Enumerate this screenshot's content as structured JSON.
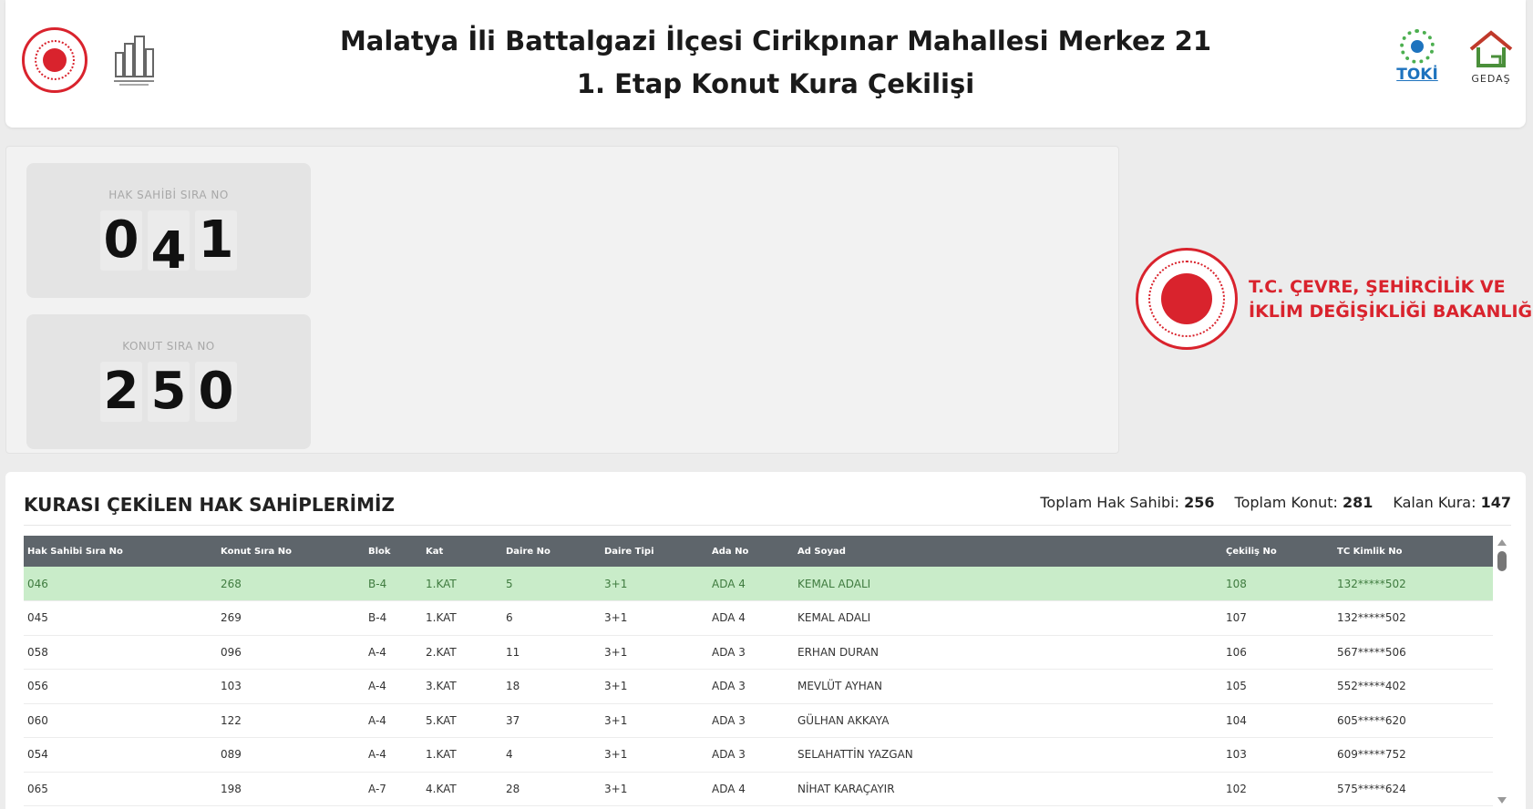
{
  "header": {
    "title_line1": "Malatya İli Battalgazi İlçesi Cirikpınar Mahallesi Merkez 21",
    "title_line2": "1. Etap Konut Kura Çekilişi",
    "toki_label": "TOKİ",
    "gedas_label": "GEDAŞ"
  },
  "counters": {
    "hak_sahibi": {
      "label": "HAK SAHİBİ SIRA NO",
      "digits": [
        "0",
        "4",
        "1"
      ]
    },
    "konut": {
      "label": "KONUT SIRA NO",
      "digits": [
        "2",
        "5",
        "0"
      ]
    }
  },
  "ministry": {
    "line1": "T.C. ÇEVRE, ŞEHİRCİLİK VE",
    "line2": "İKLİM DEĞİŞİKLİĞİ BAKANLIĞI"
  },
  "list": {
    "title": "KURASI ÇEKİLEN HAK SAHİPLERİMİZ",
    "stats": {
      "hak_sahibi_label": "Toplam Hak Sahibi:",
      "hak_sahibi_value": "256",
      "konut_label": "Toplam Konut:",
      "konut_value": "281",
      "kalan_label": "Kalan Kura:",
      "kalan_value": "147"
    },
    "columns": [
      "Hak Sahibi Sıra No",
      "Konut Sıra No",
      "Blok",
      "Kat",
      "Daire No",
      "Daire Tipi",
      "Ada No",
      "Ad Soyad",
      "Çekiliş No",
      "TC Kimlik No"
    ],
    "rows": [
      [
        "046",
        "268",
        "B-4",
        "1.KAT",
        "5",
        "3+1",
        "ADA 4",
        "KEMAL ADALI",
        "108",
        "132*****502"
      ],
      [
        "045",
        "269",
        "B-4",
        "1.KAT",
        "6",
        "3+1",
        "ADA 4",
        "KEMAL ADALI",
        "107",
        "132*****502"
      ],
      [
        "058",
        "096",
        "A-4",
        "2.KAT",
        "11",
        "3+1",
        "ADA 3",
        "ERHAN DURAN",
        "106",
        "567*****506"
      ],
      [
        "056",
        "103",
        "A-4",
        "3.KAT",
        "18",
        "3+1",
        "ADA 3",
        "MEVLÜT AYHAN",
        "105",
        "552*****402"
      ],
      [
        "060",
        "122",
        "A-4",
        "5.KAT",
        "37",
        "3+1",
        "ADA 3",
        "GÜLHAN AKKAYA",
        "104",
        "605*****620"
      ],
      [
        "054",
        "089",
        "A-4",
        "1.KAT",
        "4",
        "3+1",
        "ADA 3",
        "SELAHATTİN YAZGAN",
        "103",
        "609*****752"
      ],
      [
        "065",
        "198",
        "A-7",
        "4.KAT",
        "28",
        "3+1",
        "ADA 4",
        "NİHAT KARAÇAYIR",
        "102",
        "575*****624"
      ]
    ]
  },
  "colors": {
    "accent_red": "#d9232d",
    "header_gray": "#5e656b",
    "highlight_green": "#c9ecc9",
    "toki_blue": "#1e73be"
  }
}
